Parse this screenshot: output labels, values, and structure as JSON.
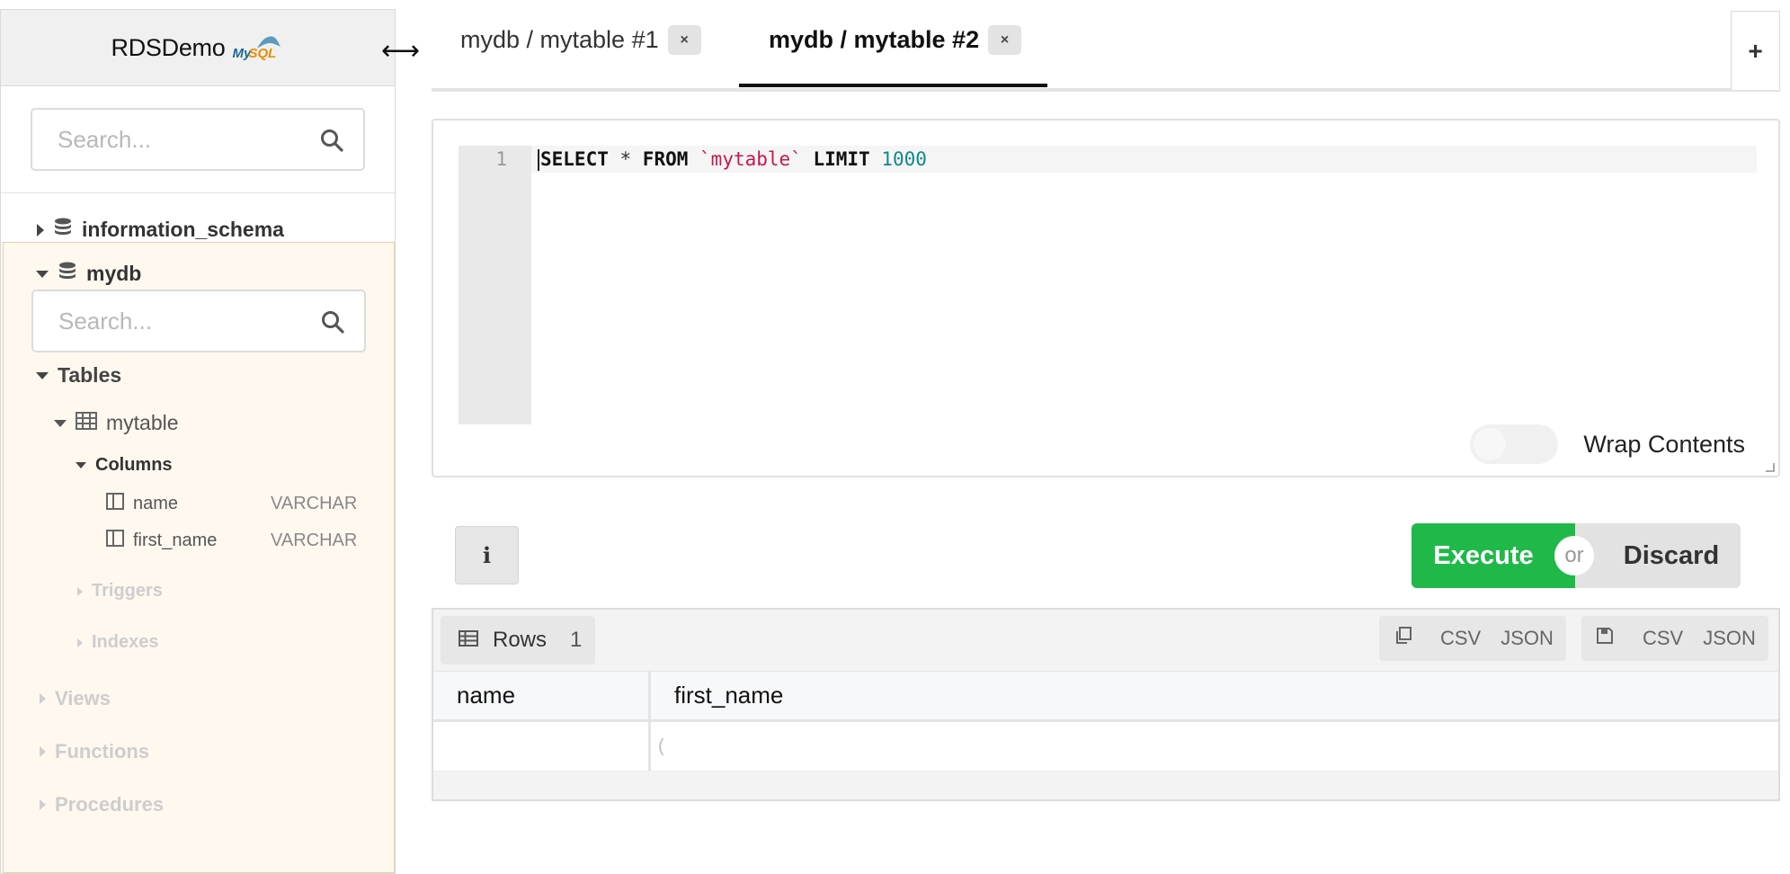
{
  "app": {
    "title": "RDSDemo",
    "logo_text_my": "My",
    "logo_text_sql": "SQL"
  },
  "sidebar": {
    "search_placeholder": "Search...",
    "databases": [
      {
        "name": "information_schema",
        "expanded": false
      },
      {
        "name": "mydb",
        "expanded": true
      }
    ],
    "mydb": {
      "search_placeholder": "Search...",
      "tables_label": "Tables",
      "table_name": "mytable",
      "columns_label": "Columns",
      "columns": [
        {
          "name": "name",
          "type": "VARCHAR"
        },
        {
          "name": "first_name",
          "type": "VARCHAR"
        }
      ],
      "triggers_label": "Triggers",
      "indexes_label": "Indexes",
      "views_label": "Views",
      "functions_label": "Functions",
      "procedures_label": "Procedures"
    }
  },
  "tabs": [
    {
      "label": "mydb / mytable #1",
      "close": "×",
      "active": false
    },
    {
      "label": "mydb / mytable #2",
      "close": "×",
      "active": true
    }
  ],
  "add_tab_label": "+",
  "editor": {
    "line_number": "1",
    "tokens": {
      "select": "SELECT",
      "star": " * ",
      "from": "FROM",
      "table": "`mytable`",
      "limit": "LIMIT",
      "limit_value": "1000"
    },
    "wrap_label": "Wrap Contents",
    "wrap_enabled": false
  },
  "actions": {
    "info_label": "i",
    "execute_label": "Execute",
    "or_label": "or",
    "discard_label": "Discard"
  },
  "results": {
    "rows_label": "Rows",
    "rows_count": "1",
    "copy_csv": "CSV",
    "copy_json": "JSON",
    "save_csv": "CSV",
    "save_json": "JSON",
    "columns": [
      "name",
      "first_name"
    ],
    "rows": [
      [
        "",
        "("
      ]
    ]
  },
  "colors": {
    "execute": "#21b84a",
    "sql_string": "#c5174f",
    "sql_number": "#11888b",
    "mydb_panel_bg": "#fff8ef"
  }
}
